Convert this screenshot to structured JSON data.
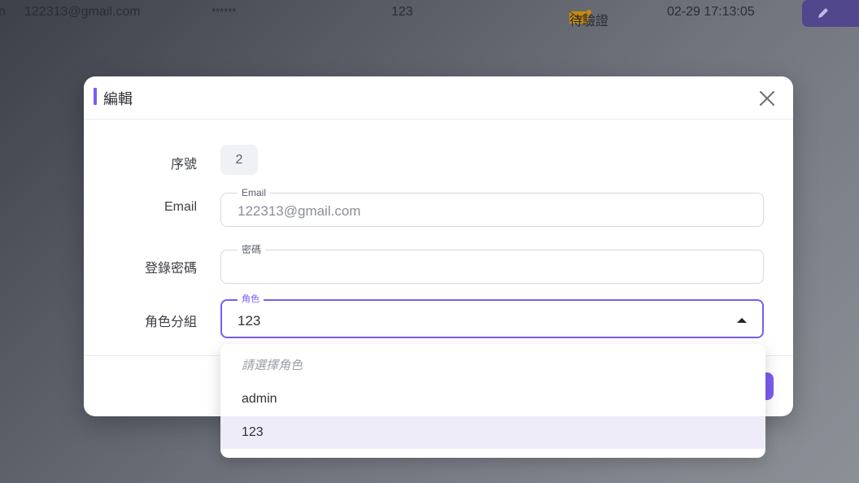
{
  "background_row": {
    "cut_text": "n",
    "email": "122313@gmail.com",
    "password_mask": "******",
    "role": "123",
    "status": "待驗證",
    "datetime": "02-29 17:13:05",
    "edit_icon": "pencil-icon"
  },
  "dialog": {
    "title": "編輯",
    "close_icon": "close-icon",
    "fields": {
      "seq_label": "序號",
      "seq_value": "2",
      "email_label": "Email",
      "email_legend": "Email",
      "email_value": "122313@gmail.com",
      "password_label": "登錄密碼",
      "password_legend": "密碼",
      "password_value": "",
      "role_label": "角色分組",
      "role_legend": "角色",
      "role_value": "123"
    }
  },
  "dropdown": {
    "options": [
      {
        "label": "請選擇角色",
        "placeholder": true
      },
      {
        "label": "admin"
      },
      {
        "label": "123",
        "selected": true
      }
    ]
  },
  "colors": {
    "accent": "#7c5cf0",
    "status_mail": "#e0a020"
  }
}
